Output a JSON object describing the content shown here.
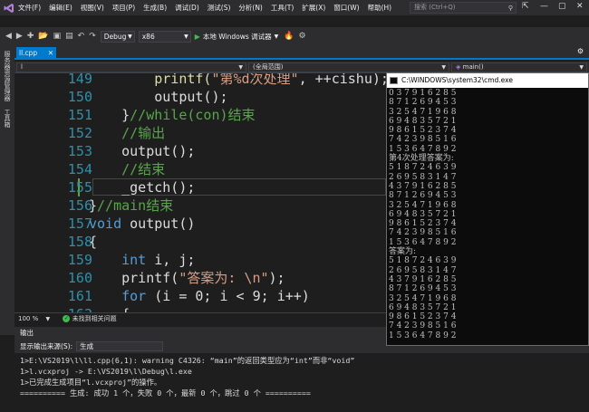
{
  "menubar": {
    "items": [
      "文件(F)",
      "编辑(E)",
      "视图(V)",
      "项目(P)",
      "生成(B)",
      "调试(D)",
      "测试(S)",
      "分析(N)",
      "工具(T)",
      "扩展(X)",
      "窗口(W)",
      "帮助(H)"
    ],
    "search_placeholder": "搜索 (Ctrl+Q)"
  },
  "toolbar": {
    "config": "Debug",
    "platform": "x86",
    "run_label": "本地 Windows 调试器"
  },
  "sidebar": {
    "tab1": "服务器资源管理器",
    "tab2": "工具箱"
  },
  "tabs": {
    "file": "ll.cpp"
  },
  "navbar": {
    "project": "l",
    "scope": "(全局范围)",
    "member": "main()"
  },
  "editor": {
    "lines": [
      {
        "num": "149",
        "indent": "        ",
        "segments": [
          {
            "t": "printf(",
            "c": "fn"
          },
          {
            "t": "\"第%d次处理\"",
            "c": "str"
          },
          {
            "t": ", ++cishu);",
            "c": ""
          }
        ]
      },
      {
        "num": "150",
        "indent": "        ",
        "segments": [
          {
            "t": "output();",
            "c": ""
          }
        ]
      },
      {
        "num": "151",
        "indent": "    ",
        "segments": [
          {
            "t": "}",
            "c": ""
          },
          {
            "t": "//while(con)结束",
            "c": "cmt"
          }
        ]
      },
      {
        "num": "152",
        "indent": "    ",
        "segments": [
          {
            "t": "//输出",
            "c": "cmt"
          }
        ]
      },
      {
        "num": "153",
        "indent": "    ",
        "segments": [
          {
            "t": "output();",
            "c": ""
          }
        ]
      },
      {
        "num": "154",
        "indent": "    ",
        "segments": [
          {
            "t": "//结束",
            "c": "cmt"
          }
        ]
      },
      {
        "num": "155",
        "indent": "    ",
        "segments": [
          {
            "t": "_getch();",
            "c": ""
          }
        ]
      },
      {
        "num": "156",
        "indent": "",
        "segments": [
          {
            "t": "}",
            "c": ""
          },
          {
            "t": "//main结束",
            "c": "cmt"
          }
        ]
      },
      {
        "num": "157",
        "indent": "",
        "segments": [
          {
            "t": "void",
            "c": "kw"
          },
          {
            "t": " output()",
            "c": ""
          }
        ]
      },
      {
        "num": "158",
        "indent": "",
        "segments": [
          {
            "t": "{",
            "c": ""
          }
        ]
      },
      {
        "num": "159",
        "indent": "    ",
        "segments": [
          {
            "t": "int",
            "c": "kw"
          },
          {
            "t": " i, j;",
            "c": ""
          }
        ]
      },
      {
        "num": "160",
        "indent": "    ",
        "segments": [
          {
            "t": "printf(",
            "c": ""
          },
          {
            "t": "\"答案为: \\n\"",
            "c": "str"
          },
          {
            "t": ");",
            "c": ""
          }
        ]
      },
      {
        "num": "161",
        "indent": "    ",
        "segments": [
          {
            "t": "for",
            "c": "kw"
          },
          {
            "t": " (i = 0; i < 9; i++)",
            "c": ""
          }
        ]
      },
      {
        "num": "162",
        "indent": "    ",
        "segments": [
          {
            "t": "{",
            "c": ""
          }
        ]
      }
    ]
  },
  "status": {
    "zoom": "100 %",
    "issues": "未找到相关问题"
  },
  "output": {
    "title": "输出",
    "source_label": "显示输出来源(S):",
    "source_value": "生成",
    "lines": [
      "1>E:\\VS2019\\l\\ll.cpp(6,1): warning C4326: “main”的返回类型应为“int”而非“void”",
      "1>l.vcxproj -> E:\\VS2019\\l\\Debug\\l.exe",
      "1>已完成生成项目“l.vcxproj”的操作。",
      "========== 生成: 成功 1 个，失败 0 个，最新 0 个，跳过 0 个 =========="
    ]
  },
  "console": {
    "title": "C:\\WINDOWS\\system32\\cmd.exe",
    "lines": [
      "0 3 7 9 1 6 2 8 5",
      "8 7 1 2 6 9 4 5 3",
      "3 2 5 4 7 1 9 6 8",
      "6 9 4 8 3 5 7 2 1",
      "9 8 6 1 5 2 3 7 4",
      "7 4 2 3 9 8 5 1 6",
      "1 5 3 6 4 7 8 9 2",
      "第4次处理答案为:",
      "5 1 8 7 2 4 6 3 9",
      "2 6 9 5 8 3 1 4 7",
      "4 3 7 9 1 6 2 8 5",
      "8 7 1 2 6 9 4 5 3",
      "3 2 5 4 7 1 9 6 8",
      "6 9 4 8 3 5 7 2 1",
      "9 8 6 1 5 2 3 7 4",
      "7 4 2 3 9 8 5 1 6",
      "1 5 3 6 4 7 8 9 2",
      "答案为:",
      "5 1 8 7 2 4 6 3 9",
      "2 6 9 5 8 3 1 4 7",
      "4 3 7 9 1 6 2 8 5",
      "8 7 1 2 6 9 4 5 3",
      "3 2 5 4 7 1 9 6 8",
      "6 9 4 8 3 5 7 2 1",
      "9 8 6 1 5 2 3 7 4",
      "7 4 2 3 9 8 5 1 6",
      "1 5 3 6 4 7 8 9 2"
    ]
  }
}
